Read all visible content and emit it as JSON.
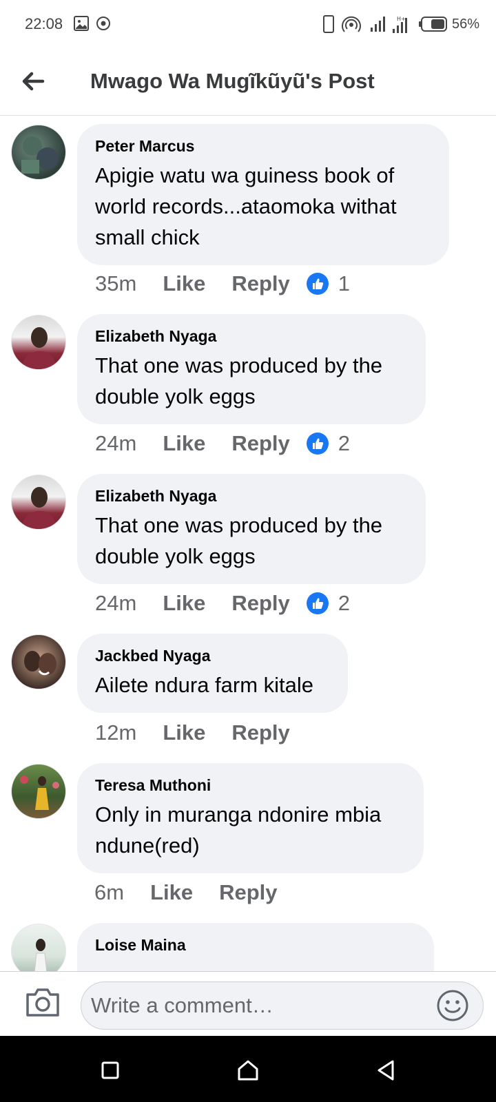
{
  "status_bar": {
    "time": "22:08",
    "battery": "56%",
    "icons": [
      "image-icon",
      "record-icon",
      "phone-icon",
      "hotspot-icon",
      "signal-icon",
      "signal-h-icon",
      "battery-icon"
    ]
  },
  "header": {
    "title": "Mwago Wa Mugĩkũyũ's Post"
  },
  "comments": [
    {
      "author": "Peter Marcus",
      "text": "Apigie watu wa guiness book of world records...ataomoka withat small chick",
      "time": "35m",
      "like": "Like",
      "reply": "Reply",
      "reactions": "1"
    },
    {
      "author": "Elizabeth Nyaga",
      "text": "That one was produced by the double yolk eggs",
      "time": "24m",
      "like": "Like",
      "reply": "Reply",
      "reactions": "2"
    },
    {
      "author": "Elizabeth Nyaga",
      "text": "That one was produced by the double yolk eggs",
      "time": "24m",
      "like": "Like",
      "reply": "Reply",
      "reactions": "2"
    },
    {
      "author": "Jackbed Nyaga",
      "text": "Ailete ndura farm kitale",
      "time": "12m",
      "like": "Like",
      "reply": "Reply"
    },
    {
      "author": "Teresa Muthoni",
      "text": "Only in muranga ndonire mbia ndune(red)",
      "time": "6m",
      "like": "Like",
      "reply": "Reply"
    },
    {
      "author": "Loise Maina"
    }
  ],
  "composer": {
    "placeholder": "Write a comment…"
  },
  "colors": {
    "bubble": "#f0f2f5",
    "like_blue": "#1877f2",
    "meta_gray": "#65676b"
  }
}
